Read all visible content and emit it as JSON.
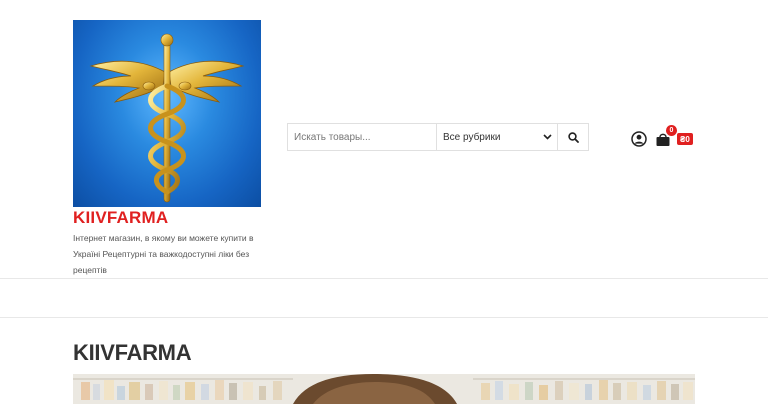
{
  "site": {
    "name": "KIIVFARMA",
    "tagline": "Інтернет магазин, в якому ви можете купити в Україні Рецептурні та важкодоступні ліки без рецептів"
  },
  "search": {
    "placeholder": "Искать товары...",
    "category_selected": "Все рубрики"
  },
  "cart": {
    "count": "0",
    "total": "₴0"
  },
  "page": {
    "title": "KIIVFARMA"
  },
  "colors": {
    "brand_red": "#e02020",
    "logo_blue": "#1665c4",
    "caduceus_gold": "#d9a72a"
  },
  "icons": {
    "logo": "caduceus-icon",
    "search": "search-icon",
    "account": "user-icon",
    "cart": "cart-icon",
    "select": "chevron-down-icon"
  }
}
